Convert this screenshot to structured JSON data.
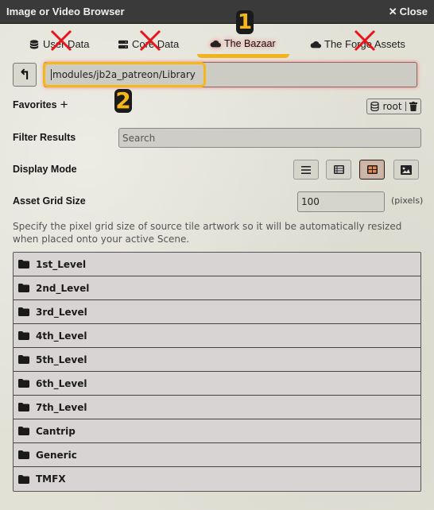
{
  "window": {
    "title": "Image or Video Browser",
    "close_label": "Close"
  },
  "tabs": [
    {
      "label": "User Data",
      "icon": "database-icon",
      "active": false,
      "crossed_out": true
    },
    {
      "label": "Core Data",
      "icon": "server-icon",
      "active": false,
      "crossed_out": true
    },
    {
      "label": "The Bazaar",
      "icon": "cloud-icon",
      "active": true,
      "crossed_out": false
    },
    {
      "label": "The Forge Assets",
      "icon": "cloud-icon",
      "active": false,
      "crossed_out": true
    }
  ],
  "annotations": {
    "marker_1": "1",
    "marker_2": "2",
    "highlight_color": "#f6b719",
    "cross_color": "#e8141a"
  },
  "path": {
    "value": "modules/jb2a_patreon/Library",
    "up_icon": "level-up-icon"
  },
  "favorites": {
    "label": "Favorites",
    "add_icon": "plus-icon",
    "source_label": "root"
  },
  "filter": {
    "label": "Filter Results",
    "placeholder": "Search",
    "value": ""
  },
  "display_mode": {
    "label": "Display Mode",
    "modes": [
      "list",
      "table",
      "tiles",
      "images"
    ],
    "selected": "tiles"
  },
  "grid_size": {
    "label": "Asset Grid Size",
    "value": "100",
    "unit": "(pixels)",
    "hint": "Specify the pixel grid size of source tile artwork so it will be automatically resized when placed onto your active Scene."
  },
  "folders": [
    "1st_Level",
    "2nd_Level",
    "3rd_Level",
    "4th_Level",
    "5th_Level",
    "6th_Level",
    "7th_Level",
    "Cantrip",
    "Generic",
    "TMFX"
  ]
}
